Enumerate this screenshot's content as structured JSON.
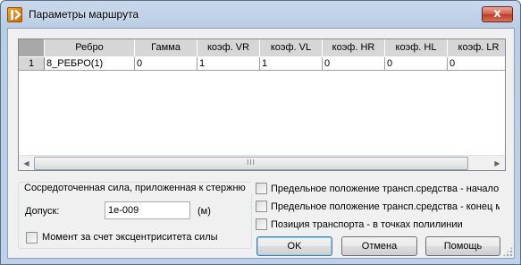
{
  "window": {
    "title": "Параметры маршрута",
    "close_glyph": "x"
  },
  "grid": {
    "columns": [
      "Ребро",
      "Гамма",
      "коэф. VR",
      "коэф. VL",
      "коэф. HR",
      "коэф. HL",
      "коэф. LR"
    ],
    "rows": [
      {
        "num": "1",
        "cells": [
          "8_РЕБРО(1)",
          "0",
          "1",
          "1",
          "0",
          "0",
          "0"
        ]
      }
    ],
    "scroll_left": "◀",
    "scroll_right": "▶",
    "scroll_grip": "III"
  },
  "group": {
    "title": "Сосредоточенная сила, приложенная к стержню",
    "tolerance_label": "Допуск:",
    "tolerance_value": "1e-009",
    "tolerance_unit": "(м)",
    "moment_label": "Момент за счет эксцентриситета силы"
  },
  "options": {
    "limit_start": "Предельное положение трансп.средства - начало маршрута",
    "limit_end": "Предельное положение трансп.средства - конец маршрута",
    "polyline_points": "Позиция транспорта - в точках полилинии"
  },
  "buttons": {
    "ok": "OK",
    "cancel": "Отмена",
    "help": "Помощь"
  }
}
